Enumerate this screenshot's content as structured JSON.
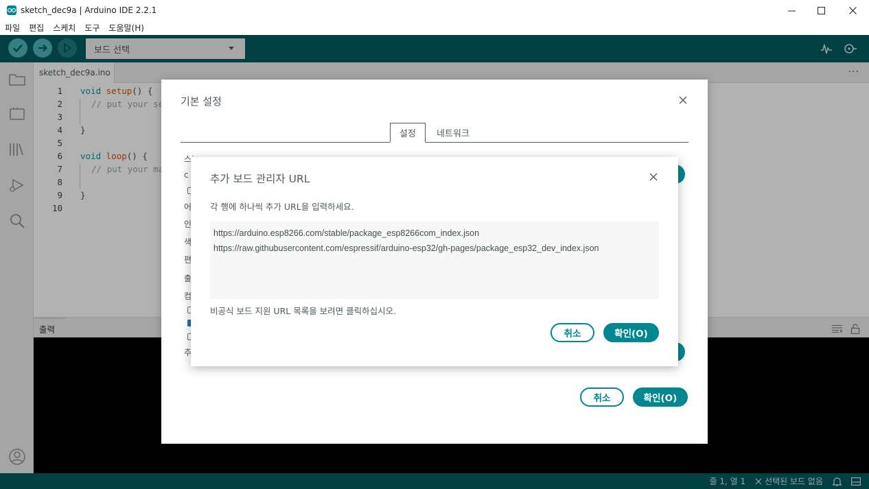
{
  "window": {
    "title": "sketch_dec9a | Arduino IDE 2.2.1",
    "minimize_glyph": "—",
    "maximize_glyph": "☐",
    "close_glyph": "✕"
  },
  "menu": {
    "items": [
      "파일",
      "편집",
      "스케치",
      "도구",
      "도움말(H)"
    ]
  },
  "toolbar": {
    "board_select": "보드 선택",
    "buttons": [
      "verify-icon",
      "upload-icon",
      "debug-icon"
    ],
    "right_icons": [
      "serial-plotter-icon",
      "serial-monitor-icon"
    ]
  },
  "sidebar": {
    "icons": [
      "folder-icon",
      "board-manager-icon",
      "library-icon",
      "debug-run-icon",
      "search-icon",
      "account-icon"
    ]
  },
  "editor": {
    "tab_name": "sketch_dec9a.ino",
    "tab_more": "···",
    "lines": [
      "1",
      "2",
      "3",
      "4",
      "5",
      "6",
      "7",
      "8",
      "9",
      "10"
    ],
    "code": {
      "l1_kw": "void",
      "l1_fn": "setup",
      "l1_rest": "() {",
      "l2_cm": "// put your se",
      "l4": "}",
      "l6_kw": "void",
      "l6_fn": "loop",
      "l6_rest": "() {",
      "l7_cm": "// put your ma",
      "l9": "}"
    }
  },
  "output": {
    "tab_label": "출력",
    "icons": [
      "clear-output-icon",
      "lock-icon"
    ]
  },
  "status": {
    "position": "줄 1, 열 1",
    "board": "선택된 보드 없음",
    "icons": [
      "notification-icon",
      "panel-toggle-icon"
    ]
  },
  "prefs_dialog": {
    "title": "기본 설정",
    "tabs": [
      "설정",
      "네트워크"
    ],
    "active_tab": "설정",
    "fragments": [
      "스케치북 위치",
      "c",
      "어",
      "인",
      "색",
      "편",
      "출",
      "컴",
      "추"
    ],
    "cancel": "취소",
    "ok": "확인(O)"
  },
  "urls_dialog": {
    "title": "추가 보드 관리자 URL",
    "hint": "각 행에 하나씩 추가 URL을 입력하세요.",
    "urls": [
      "https://arduino.esp8266.com/stable/package_esp8266com_index.json",
      "https://raw.githubusercontent.com/espressif/arduino-esp32/gh-pages/package_esp32_dev_index.json"
    ],
    "link": "비공식 보드 지원 URL 목록을 보려면 클릭하십시오.",
    "cancel": "취소",
    "ok": "확인(O)"
  },
  "colors": {
    "accent": "#00878f",
    "toolbar": "#005c5f"
  }
}
